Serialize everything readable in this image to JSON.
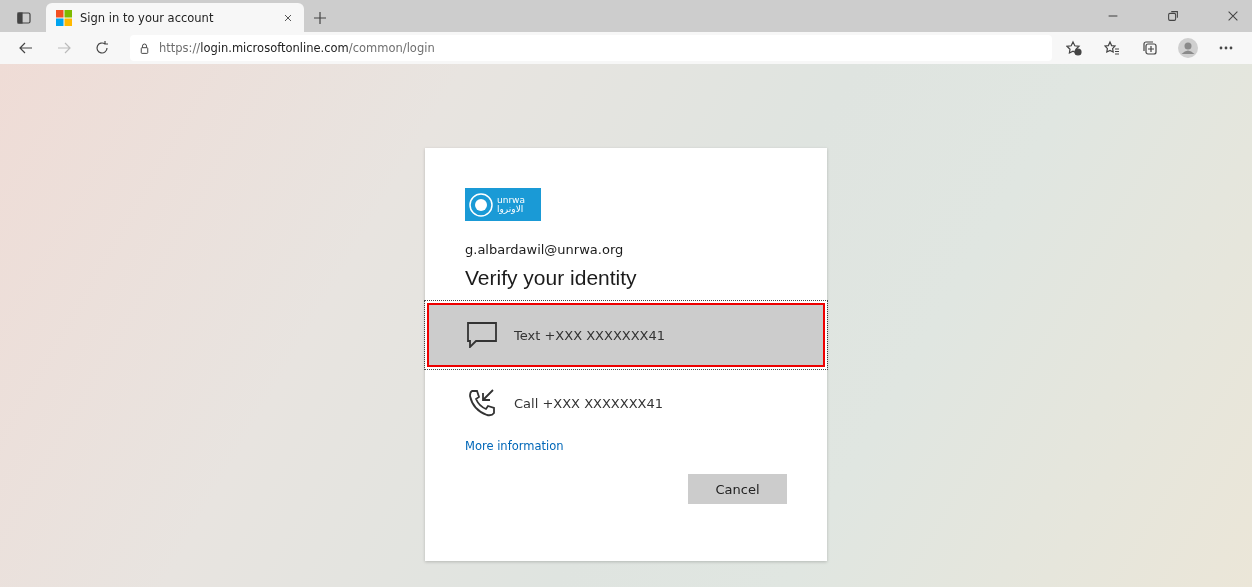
{
  "browser": {
    "tab": {
      "title": "Sign in to your account",
      "selected": true
    },
    "address": {
      "scheme": "https://",
      "host": "login.microsoftonline.com",
      "path": "/common/login"
    }
  },
  "card": {
    "logo": {
      "latin": "unrwa",
      "arabic": "الاونروا"
    },
    "account": "g.albardawil@unrwa.org",
    "title": "Verify your identity",
    "options": [
      {
        "kind": "text",
        "label": "Text +XXX XXXXXXX41",
        "selected": true
      },
      {
        "kind": "call",
        "label": "Call +XXX XXXXXXX41",
        "selected": false
      }
    ],
    "link": "More information",
    "buttons": [
      "Cancel"
    ]
  }
}
